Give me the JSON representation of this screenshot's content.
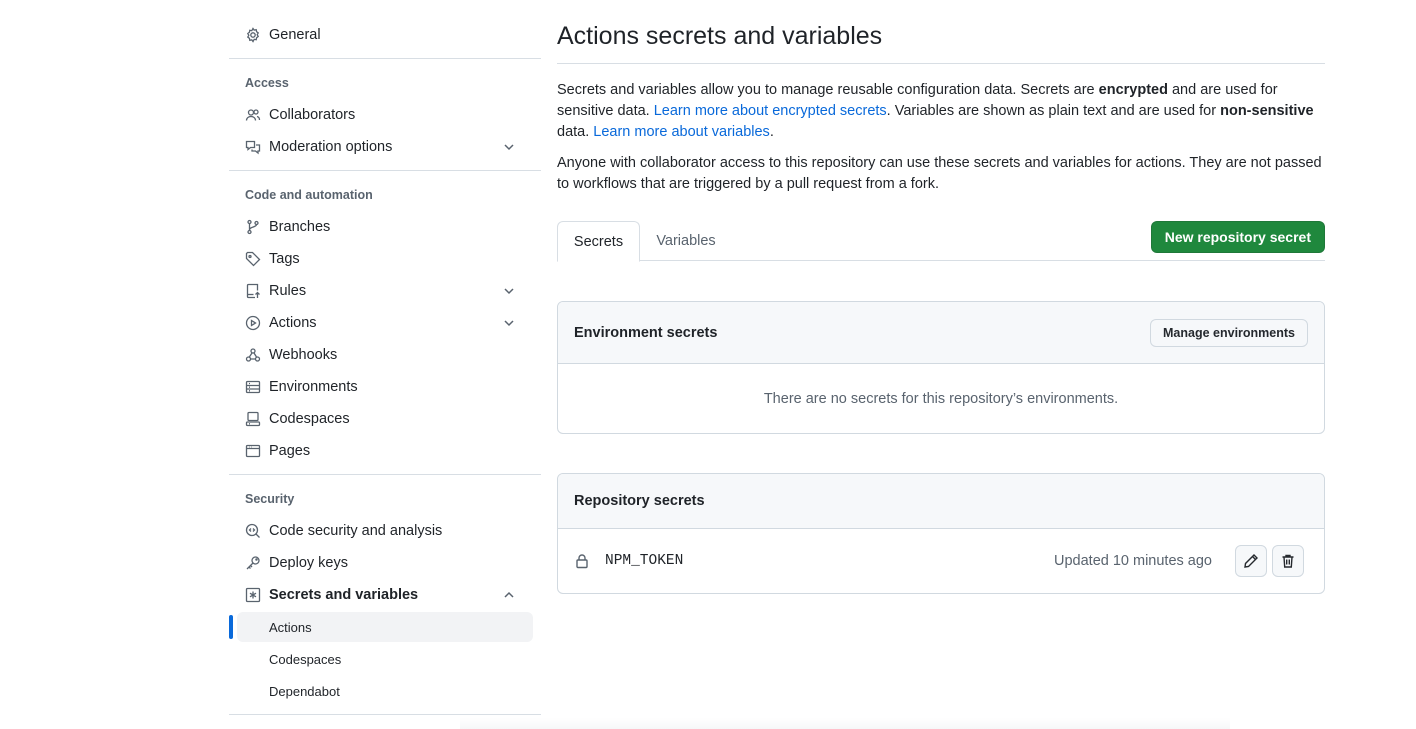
{
  "sidebar": {
    "general": "General",
    "access_heading": "Access",
    "access_items": {
      "collaborators": "Collaborators",
      "moderation": "Moderation options"
    },
    "code_heading": "Code and automation",
    "code_items": {
      "branches": "Branches",
      "tags": "Tags",
      "rules": "Rules",
      "actions": "Actions",
      "webhooks": "Webhooks",
      "environments": "Environments",
      "codespaces": "Codespaces",
      "pages": "Pages"
    },
    "security_heading": "Security",
    "security_items": {
      "code_security": "Code security and analysis",
      "deploy_keys": "Deploy keys",
      "secrets_variables": "Secrets and variables"
    },
    "secrets_sub": {
      "actions": "Actions",
      "codespaces": "Codespaces",
      "dependabot": "Dependabot"
    },
    "active_item": "Actions",
    "accent_color": "#0969da"
  },
  "main": {
    "title": "Actions secrets and variables",
    "intro": {
      "p1_a": "Secrets and variables allow you to manage reusable configuration data. Secrets are ",
      "p1_bold1": "encrypted",
      "p1_b": " and are used for sensitive data. ",
      "p1_link1": "Learn more about encrypted secrets",
      "p1_c": ". Variables are shown as plain text and are used for ",
      "p1_bold2": "non-sensitive",
      "p1_d": " data. ",
      "p1_link2": "Learn more about variables",
      "p1_e": ".",
      "p2": "Anyone with collaborator access to this repository can use these secrets and variables for actions. They are not passed to workflows that are triggered by a pull request from a fork."
    },
    "tabs": {
      "secrets": "Secrets",
      "variables": "Variables",
      "selected": "Secrets"
    },
    "new_secret_button": "New repository secret",
    "environment_secrets": {
      "heading": "Environment secrets",
      "manage_button": "Manage environments",
      "empty_message": "There are no secrets for this repository’s environments."
    },
    "repository_secrets": {
      "heading": "Repository secrets",
      "rows": [
        {
          "name": "NPM_TOKEN",
          "updated": "Updated 10 minutes ago"
        }
      ]
    }
  },
  "colors": {
    "primary_button": "#1f883d",
    "link": "#0969da",
    "muted_text": "#59636e"
  }
}
